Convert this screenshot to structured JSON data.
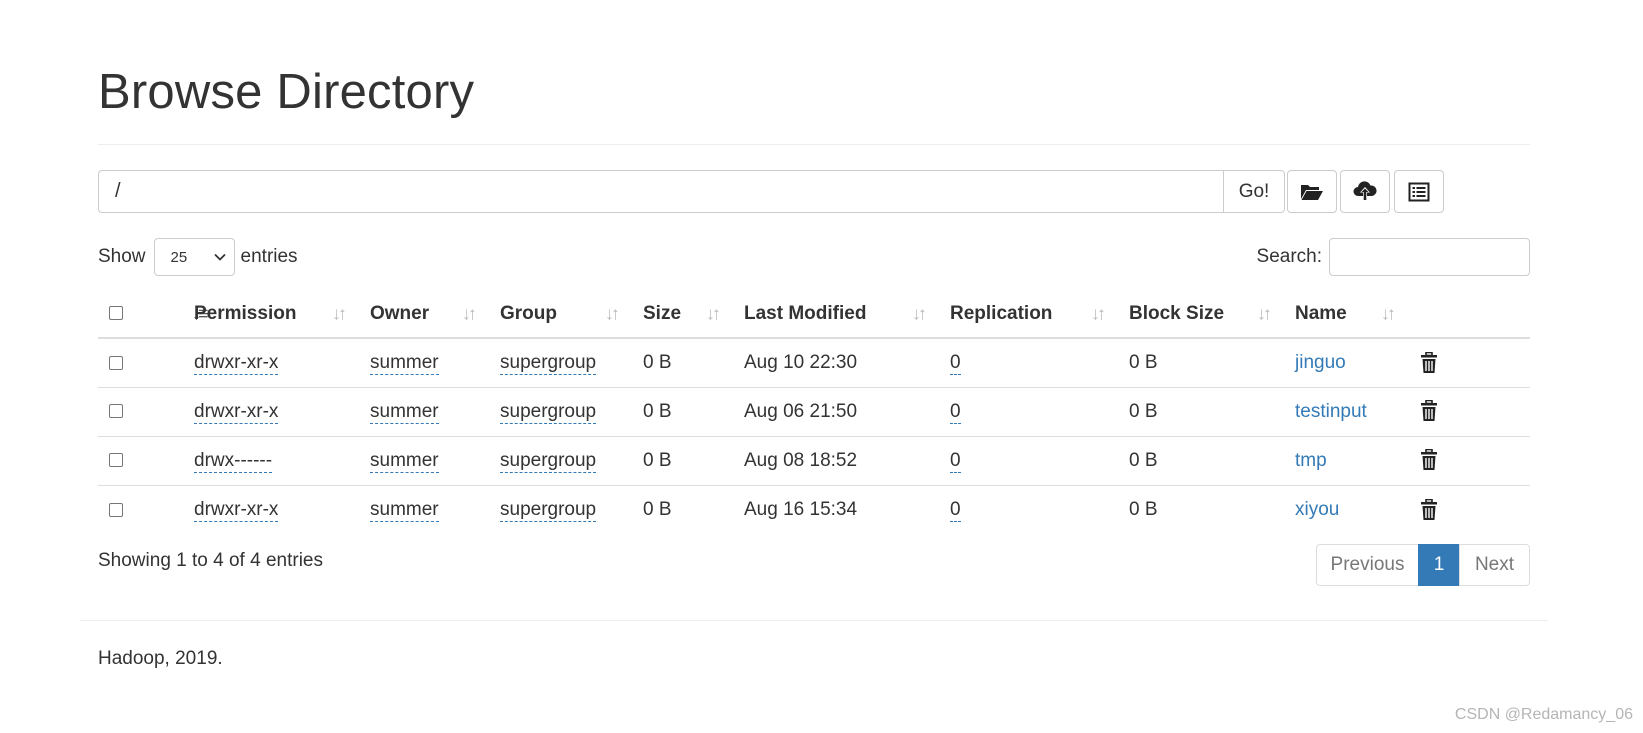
{
  "page": {
    "title": "Browse Directory"
  },
  "path_bar": {
    "value": "/",
    "go_label": "Go!"
  },
  "toolbar": {
    "icons": [
      "folder-open-icon",
      "cloud-upload-icon",
      "list-alt-icon"
    ]
  },
  "length_menu": {
    "prefix": "Show",
    "selected": "25",
    "suffix": "entries"
  },
  "search": {
    "label": "Search:",
    "value": ""
  },
  "table": {
    "columns": [
      "Permission",
      "Owner",
      "Group",
      "Size",
      "Last Modified",
      "Replication",
      "Block Size",
      "Name"
    ],
    "rows": [
      {
        "permission": "drwxr-xr-x",
        "owner": "summer",
        "group": "supergroup",
        "size": "0 B",
        "modified": "Aug 10 22:30",
        "replication": "0",
        "block_size": "0 B",
        "name": "jinguo"
      },
      {
        "permission": "drwxr-xr-x",
        "owner": "summer",
        "group": "supergroup",
        "size": "0 B",
        "modified": "Aug 06 21:50",
        "replication": "0",
        "block_size": "0 B",
        "name": "testinput"
      },
      {
        "permission": "drwx------",
        "owner": "summer",
        "group": "supergroup",
        "size": "0 B",
        "modified": "Aug 08 18:52",
        "replication": "0",
        "block_size": "0 B",
        "name": "tmp"
      },
      {
        "permission": "drwxr-xr-x",
        "owner": "summer",
        "group": "supergroup",
        "size": "0 B",
        "modified": "Aug 16 15:34",
        "replication": "0",
        "block_size": "0 B",
        "name": "xiyou"
      }
    ]
  },
  "info": {
    "text": "Showing 1 to 4 of 4 entries"
  },
  "pagination": {
    "previous": "Previous",
    "current": "1",
    "next": "Next"
  },
  "footer": {
    "text": "Hadoop, 2019."
  },
  "watermark": {
    "text": "CSDN @Redamancy_06"
  },
  "colors": {
    "link": "#337ab7",
    "active_page": "#337ab7",
    "border": "#dddddd"
  }
}
